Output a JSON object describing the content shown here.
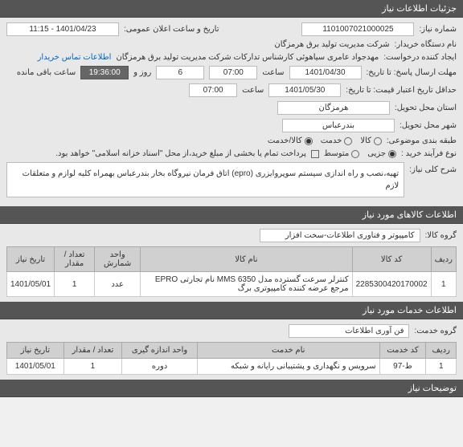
{
  "header": {
    "details_title": "جزئیات اطلاعات نیاز"
  },
  "form": {
    "need_number_label": "شماره نیاز:",
    "need_number": "1101007021000025",
    "announce_label": "تاریخ و ساعت اعلان عمومی:",
    "announce_value": "1401/04/23 - 11:15",
    "buyer_org_label": "نام دستگاه خریدار:",
    "buyer_org": "شرکت مدیریت تولید برق هرمزگان",
    "requester_label": "ایجاد کننده درخواست:",
    "requester": "مهدجواد عامری سیاهوئی کارشناس تدارکات شرکت مدیریت تولید برق هرمزگان",
    "contact_link": "اطلاعات تماس خریدار",
    "deadline_label": "مهلت ارسال پاسخ: تا تاریخ:",
    "deadline_date": "1401/04/30",
    "deadline_time_label": "ساعت",
    "deadline_time": "07:00",
    "days": "6",
    "days_label": "روز و",
    "countdown": "19:36:00",
    "remaining_label": "ساعت باقی مانده",
    "validity_label": "حداقل تاریخ اعتبار قیمت: تا تاریخ:",
    "validity_date": "1401/05/30",
    "validity_time": "07:00",
    "province_label": "استان محل تحویل:",
    "province": "هرمزگان",
    "city_label": "شهر محل تحویل:",
    "city": "بندرعباس",
    "classification_label": "طبقه بندی موضوعی:",
    "classification_options": [
      "کالا",
      "خدمت",
      "کالا/خدمت"
    ],
    "purchase_type_label": "نوع فرآیند خرید :",
    "purchase_type_options": [
      "جزیی",
      "متوسط"
    ],
    "payment_note": "پرداخت تمام یا بخشی از مبلغ خرید،از محل \"اسناد خزانه اسلامی\" خواهد بود.",
    "general_desc_label": "شرح کلی نیاز:",
    "general_desc": "تهیه،نصب و راه اندازی سیستم سوپروایزری (epro) اتاق فرمان نیروگاه بخار بندرعباس بهمراه کلیه لوازم و متعلقات لازم"
  },
  "goods": {
    "section_title": "اطلاعات کالاهای مورد نیاز",
    "group_label": "گروه کالا:",
    "group_value": "کامپیوتر و فناوری اطلاعات-سخت افزار",
    "columns": [
      "ردیف",
      "کد کالا",
      "نام کالا",
      "واحد شمارش",
      "تعداد / مقدار",
      "تاریخ نیاز"
    ],
    "rows": [
      {
        "idx": "1",
        "code": "2285300420170002",
        "name": "کنترلر سرعت گسترده مدل MMS 6350 نام تجارتی EPRO مرجع عرضه کننده کامپیوتری برگ",
        "unit": "عدد",
        "qty": "1",
        "date": "1401/05/01"
      }
    ]
  },
  "services": {
    "section_title": "اطلاعات خدمات مورد نیاز",
    "group_label": "گروه خدمت:",
    "group_value": "فن آوری اطلاعات",
    "columns": [
      "ردیف",
      "کد خدمت",
      "نام خدمت",
      "واحد اندازه گیری",
      "تعداد / مقدار",
      "تاریخ نیاز"
    ],
    "rows": [
      {
        "idx": "1",
        "code": "ط-97",
        "name": "سرویس و نگهداری و پشتیبانی رایانه و شبکه",
        "unit": "دوره",
        "qty": "1",
        "date": "1401/05/01"
      }
    ]
  },
  "notes": {
    "section_title": "توضیحات نیاز"
  }
}
